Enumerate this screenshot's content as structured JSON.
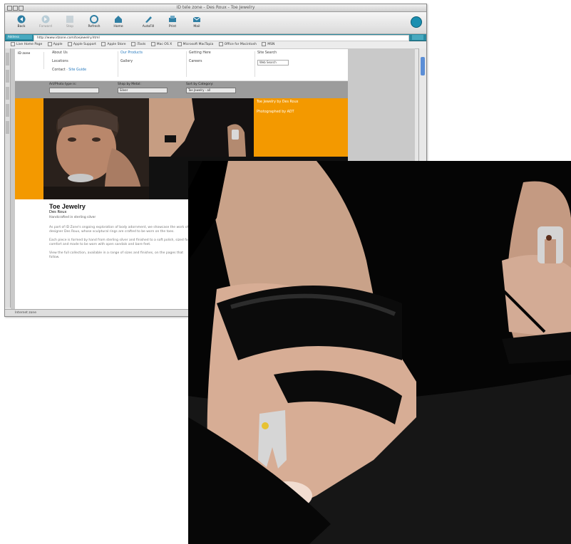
{
  "browser": {
    "title": "ID tele zone - Des Roux - Toe Jewelry",
    "toolbar": [
      {
        "label": "Back",
        "icon": "back-arrow-icon"
      },
      {
        "label": "Forward",
        "icon": "forward-arrow-icon"
      },
      {
        "label": "Stop",
        "icon": "stop-icon"
      },
      {
        "label": "Refresh",
        "icon": "refresh-icon"
      },
      {
        "label": "Home",
        "icon": "home-icon"
      },
      {
        "label": "AutoFill",
        "icon": "autofill-icon"
      },
      {
        "label": "Print",
        "icon": "print-icon"
      },
      {
        "label": "Mail",
        "icon": "mail-icon"
      }
    ],
    "address_label": "Address",
    "address_value": "http://www.idzone.com/toejewelry.html",
    "favorites": [
      "Live Home Page",
      "Apple",
      "Apple Support",
      "Apple Store",
      "iTools",
      "Mac OS X",
      "Microsoft MacTopia",
      "Office for Macintosh",
      "MSN"
    ],
    "status": "Internet zone"
  },
  "page": {
    "logo": "ID zone",
    "nav_cols": [
      {
        "items": [
          "About Us",
          "Locations",
          "Contact",
          "Site Guide"
        ]
      },
      {
        "items": [
          "Our Products",
          "Gallery"
        ]
      },
      {
        "items": [
          "Getting Here",
          "Careers"
        ]
      },
      {
        "items": [
          "Site Search"
        ]
      }
    ],
    "search_select": "Web Search",
    "filters": [
      {
        "label": "Art/Photo type is:",
        "value": ""
      },
      {
        "label": "Shop by Metal:",
        "value": "Silver"
      },
      {
        "label": "Sort by Category:",
        "value": "Toe Jewelry - all"
      }
    ],
    "hero_text": [
      "Toe Jewelry by Des Roux",
      "Photographed by ADT"
    ],
    "article": {
      "title": "Toe Jewelry",
      "subtitle": "Des Roux",
      "kicker": "Handcrafted in sterling silver",
      "paragraphs": [
        "As part of ID Zone's ongoing exploration of body adornment, we showcase the work of designer Des Roux, whose sculptural rings are crafted to be worn on the toes.",
        "Each piece is formed by hand from sterling silver and finished to a soft polish, sized for comfort and made to be worn with open sandals and bare feet.",
        "View the full collection, available in a range of sizes and finishes, on the pages that follow."
      ]
    }
  },
  "colors": {
    "accent_orange": "#f39900",
    "address_teal": "#2a8aa0"
  }
}
